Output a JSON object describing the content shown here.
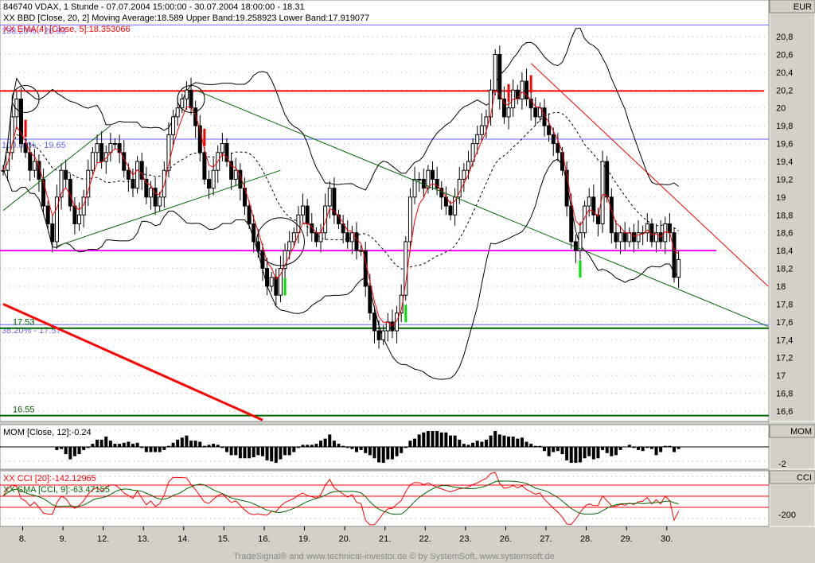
{
  "header": {
    "title": "846740  VDAX, 1 Stunde - 07.07.2004 15:00:00 - 30.07.2004 18:00:00 - 18.31",
    "bbd": "XX BBD [Close, 20, 2] Moving Average:18.589 Upper Band:19.258923 Lower Band:17.919077",
    "ema": "XX EMA(4) [Close, 5]:18.353066"
  },
  "footer": "TradeSignal® and www.technical-investor.de © by  SystemSoft, www.systemsoft.de",
  "mom_panel": {
    "label": "MOM [Close, 12]:-0.24",
    "axis_title": "MOM",
    "tick": "-2"
  },
  "cci_panel": {
    "label_cci": "XX CCI [20]:-142.12965",
    "label_sma": "XX SMA [CCI, 9]:-63.47155",
    "axis_title": "CCI",
    "tick": "-200"
  },
  "colors": {
    "candle": "#000000",
    "ema": "#ff0000",
    "bands": "#000000",
    "resistance": "#ff0000",
    "support": "#ff00ff",
    "fib": "#6666ff",
    "green": "#006600"
  },
  "chart_data": {
    "type": "candlestick",
    "title": "846740  VDAX, 1 Stunde",
    "currency": "EUR",
    "ylim": [
      16.5,
      20.95
    ],
    "yticks": [
      "20,8",
      "20,6",
      "20,4",
      "20,2",
      "20",
      "19,8",
      "19,6",
      "19,4",
      "19,2",
      "19",
      "18,8",
      "18,6",
      "18,4",
      "18,2",
      "18",
      "17,8",
      "17,6",
      "17,4",
      "17,2",
      "17",
      "16,8",
      "16,6"
    ],
    "xticks": [
      "8.",
      "9.",
      "12.",
      "13.",
      "14.",
      "15.",
      "16.",
      "19.",
      "20.",
      "21.",
      "22.",
      "23.",
      "26.",
      "27.",
      "28.",
      "29.",
      "30."
    ],
    "closes": [
      19.3,
      19.5,
      19.9,
      20.1,
      19.6,
      19.5,
      19.3,
      19.4,
      19.2,
      18.9,
      18.7,
      18.5,
      19.0,
      19.3,
      19.2,
      18.9,
      18.7,
      18.8,
      19.0,
      19.3,
      19.5,
      19.6,
      19.4,
      19.5,
      19.6,
      19.6,
      19.5,
      19.3,
      19.2,
      19.1,
      19.4,
      19.2,
      19.0,
      19.1,
      18.9,
      19.0,
      19.3,
      19.7,
      19.9,
      20.0,
      20.1,
      20.2,
      20.0,
      19.8,
      19.5,
      19.2,
      19.1,
      19.3,
      19.5,
      19.6,
      19.4,
      19.2,
      19.3,
      19.1,
      18.9,
      18.7,
      18.5,
      18.4,
      18.2,
      18.0,
      18.1,
      17.9,
      18.2,
      18.4,
      18.5,
      18.6,
      18.8,
      18.9,
      18.7,
      18.6,
      18.5,
      18.6,
      18.9,
      19.1,
      18.8,
      18.7,
      18.6,
      18.5,
      18.6,
      18.4,
      18.4,
      18.0,
      17.7,
      17.5,
      17.4,
      17.5,
      17.6,
      17.5,
      17.7,
      17.9,
      18.5,
      19.0,
      19.2,
      19.2,
      19.1,
      19.3,
      19.2,
      19.1,
      19.0,
      18.9,
      18.8,
      19.0,
      19.2,
      19.3,
      19.4,
      19.6,
      19.7,
      19.8,
      19.9,
      20.2,
      20.6,
      20.1,
      19.9,
      20.0,
      20.2,
      20.1,
      20.3,
      20.1,
      20.0,
      19.9,
      20.0,
      19.8,
      19.7,
      19.6,
      19.5,
      19.3,
      18.9,
      18.5,
      18.4,
      18.6,
      18.9,
      19.0,
      18.8,
      18.7,
      19.4,
      19.0,
      18.6,
      18.5,
      18.6,
      18.5,
      18.6,
      18.5,
      18.6,
      18.6,
      18.7,
      18.5,
      18.6,
      18.5,
      18.7,
      18.6,
      18.1,
      18.3
    ],
    "hlines": [
      {
        "price": 20.93,
        "color": "#6666ff",
        "label": "138.20% - 20.93"
      },
      {
        "price": 20.19,
        "color": "#ff0000",
        "label": ""
      },
      {
        "price": 19.65,
        "color": "#6666ff",
        "label": "100.00% - 19.65"
      },
      {
        "price": 18.4,
        "color": "#ff00ff",
        "label": ""
      },
      {
        "price": 17.57,
        "color": "#6666ff",
        "label": "38.20% - 17.57"
      },
      {
        "price": 17.53,
        "color": "#006600",
        "label": "17.53"
      },
      {
        "price": 16.55,
        "color": "#006600",
        "label": "16.55"
      }
    ],
    "trendlines": [
      {
        "from": [
          118,
          20.5
        ],
        "to": [
          171,
          18.0
        ],
        "color": "#ff0000"
      },
      {
        "from": [
          43,
          20.2
        ],
        "to": [
          171,
          17.55
        ],
        "color": "#006600"
      },
      {
        "from": [
          0,
          17.8
        ],
        "to": [
          58,
          16.5
        ],
        "color": "#ff0000",
        "thick": true
      },
      {
        "from": [
          12,
          18.45
        ],
        "to": [
          62,
          19.3
        ],
        "color": "#006600"
      },
      {
        "from": [
          0,
          18.85
        ],
        "to": [
          24,
          19.8
        ],
        "color": "#006600"
      }
    ],
    "sell_signals": [
      5,
      45,
      113,
      118
    ],
    "buy_signals": [
      63,
      90,
      129
    ],
    "circles": [
      [
        5,
        20.1
      ],
      [
        42,
        20.1
      ],
      [
        62,
        18.5
      ]
    ]
  }
}
